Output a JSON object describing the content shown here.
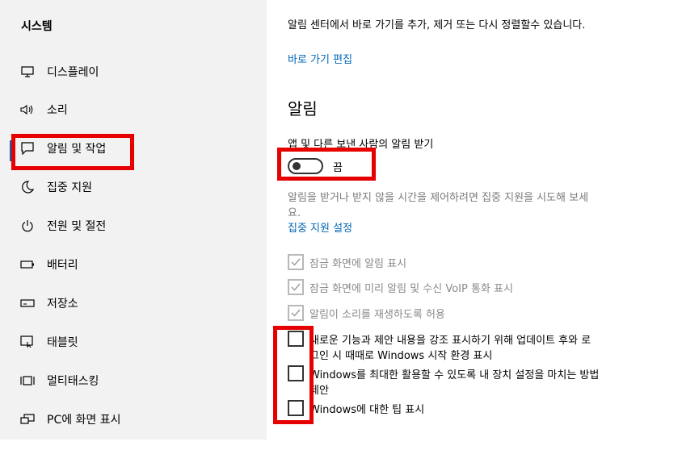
{
  "sidebar": {
    "title": "시스템",
    "items": [
      {
        "label": "디스플레이",
        "icon": "monitor-icon"
      },
      {
        "label": "소리",
        "icon": "speaker-icon"
      },
      {
        "label": "알림 및 작업",
        "icon": "notification-icon"
      },
      {
        "label": "집중 지원",
        "icon": "moon-icon"
      },
      {
        "label": "전원 및 절전",
        "icon": "power-icon"
      },
      {
        "label": "배터리",
        "icon": "battery-icon"
      },
      {
        "label": "저장소",
        "icon": "storage-icon"
      },
      {
        "label": "태블릿",
        "icon": "tablet-icon"
      },
      {
        "label": "멀티태스킹",
        "icon": "multitasking-icon"
      },
      {
        "label": "PC에 화면 표시",
        "icon": "project-icon"
      }
    ]
  },
  "main": {
    "intro_text": "알림 센터에서 바로 가기를 추가, 제거 또는 다시 정렬할수 있습니다.",
    "edit_shortcuts_link": "바로 가기 편집",
    "section_title": "알림",
    "get_notifications_label": "앱 및 다른 보낸 사람의 알림 받기",
    "toggle_state": "끔",
    "focus_text_line1": "알림을 받거나 받지 않을 시간을 제어하려면 집중 지원을 시도해 보세",
    "focus_text_line2": "요.",
    "focus_settings_link": "집중 지원 설정",
    "checkboxes": [
      {
        "label": "잠금 화면에 알림 표시",
        "checked": true,
        "disabled": true
      },
      {
        "label": "잠금 화면에 미리 알림 및 수신 VoIP 통화 표시",
        "checked": true,
        "disabled": true
      },
      {
        "label": "알림이 소리를 재생하도록 허용",
        "checked": true,
        "disabled": true
      },
      {
        "label_line1": "새로운 기능과 제안 내용을 강조 표시하기 위해 업데이트 후와 로",
        "label_line2": "그인 시 때때로 Windows 시작 환경 표시",
        "checked": false,
        "disabled": false
      },
      {
        "label_line1": "Windows를 최대한 활용할 수 있도록 내 장치 설정을 마치는 방법",
        "label_line2": "제안",
        "checked": false,
        "disabled": false
      },
      {
        "label": "Windows에 대한 팁 표시",
        "checked": false,
        "disabled": false
      }
    ]
  },
  "colors": {
    "accent": "#0067c0",
    "link": "#0067b8",
    "highlight": "#e60000",
    "sidebar_bg": "#f2f2f2",
    "active_bg": "#dcdcdc"
  }
}
